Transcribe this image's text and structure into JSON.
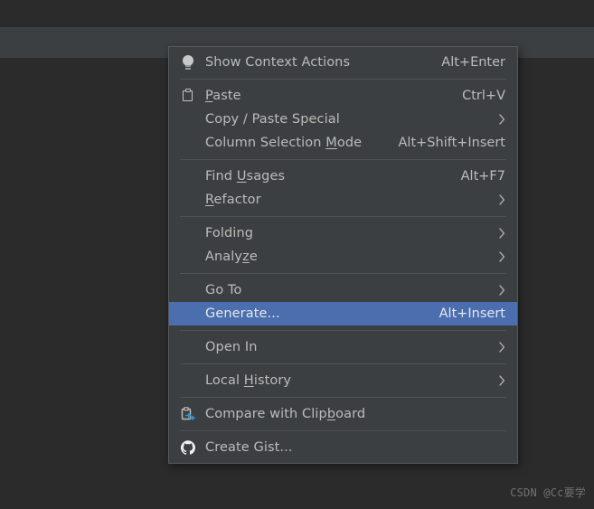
{
  "window": {
    "background_color": "#2b2b2b",
    "tabstrip_color": "#3c3f41"
  },
  "context_menu": {
    "background_color": "#3c3f41",
    "border_color": "#565a5c",
    "text_color": "#bbbbbb",
    "highlight_color": "#4b6eaf",
    "groups": [
      {
        "items": [
          {
            "label": "Show Context Actions",
            "mnemonic": "",
            "shortcut": "Alt+Enter",
            "icon": "lightbulb-icon",
            "submenu": false,
            "selected": false
          }
        ]
      },
      {
        "items": [
          {
            "label": "Paste",
            "mnemonic": "P",
            "shortcut": "Ctrl+V",
            "icon": "clipboard-icon",
            "submenu": false,
            "selected": false
          },
          {
            "label": "Copy / Paste Special",
            "mnemonic": "",
            "shortcut": "",
            "icon": "",
            "submenu": true,
            "selected": false
          },
          {
            "label": "Column Selection Mode",
            "mnemonic": "M",
            "shortcut": "Alt+Shift+Insert",
            "icon": "",
            "submenu": false,
            "selected": false
          }
        ]
      },
      {
        "items": [
          {
            "label": "Find Usages",
            "mnemonic": "U",
            "shortcut": "Alt+F7",
            "icon": "",
            "submenu": false,
            "selected": false
          },
          {
            "label": "Refactor",
            "mnemonic": "R",
            "shortcut": "",
            "icon": "",
            "submenu": true,
            "selected": false
          }
        ]
      },
      {
        "items": [
          {
            "label": "Folding",
            "mnemonic": "",
            "shortcut": "",
            "icon": "",
            "submenu": true,
            "selected": false
          },
          {
            "label": "Analyze",
            "mnemonic": "z",
            "shortcut": "",
            "icon": "",
            "submenu": true,
            "selected": false
          }
        ]
      },
      {
        "items": [
          {
            "label": "Go To",
            "mnemonic": "",
            "shortcut": "",
            "icon": "",
            "submenu": true,
            "selected": false
          },
          {
            "label": "Generate...",
            "mnemonic": "",
            "shortcut": "Alt+Insert",
            "icon": "",
            "submenu": false,
            "selected": true
          }
        ]
      },
      {
        "items": [
          {
            "label": "Open In",
            "mnemonic": "",
            "shortcut": "",
            "icon": "",
            "submenu": true,
            "selected": false
          }
        ]
      },
      {
        "items": [
          {
            "label": "Local History",
            "mnemonic": "H",
            "shortcut": "",
            "icon": "",
            "submenu": true,
            "selected": false
          }
        ]
      },
      {
        "items": [
          {
            "label": "Compare with Clipboard",
            "mnemonic": "b",
            "shortcut": "",
            "icon": "compare-clipboard-icon",
            "submenu": false,
            "selected": false
          }
        ]
      },
      {
        "items": [
          {
            "label": "Create Gist...",
            "mnemonic": "",
            "shortcut": "",
            "icon": "github-icon",
            "submenu": false,
            "selected": false
          }
        ]
      }
    ]
  },
  "watermark": {
    "text": "CSDN @Cc要学"
  }
}
